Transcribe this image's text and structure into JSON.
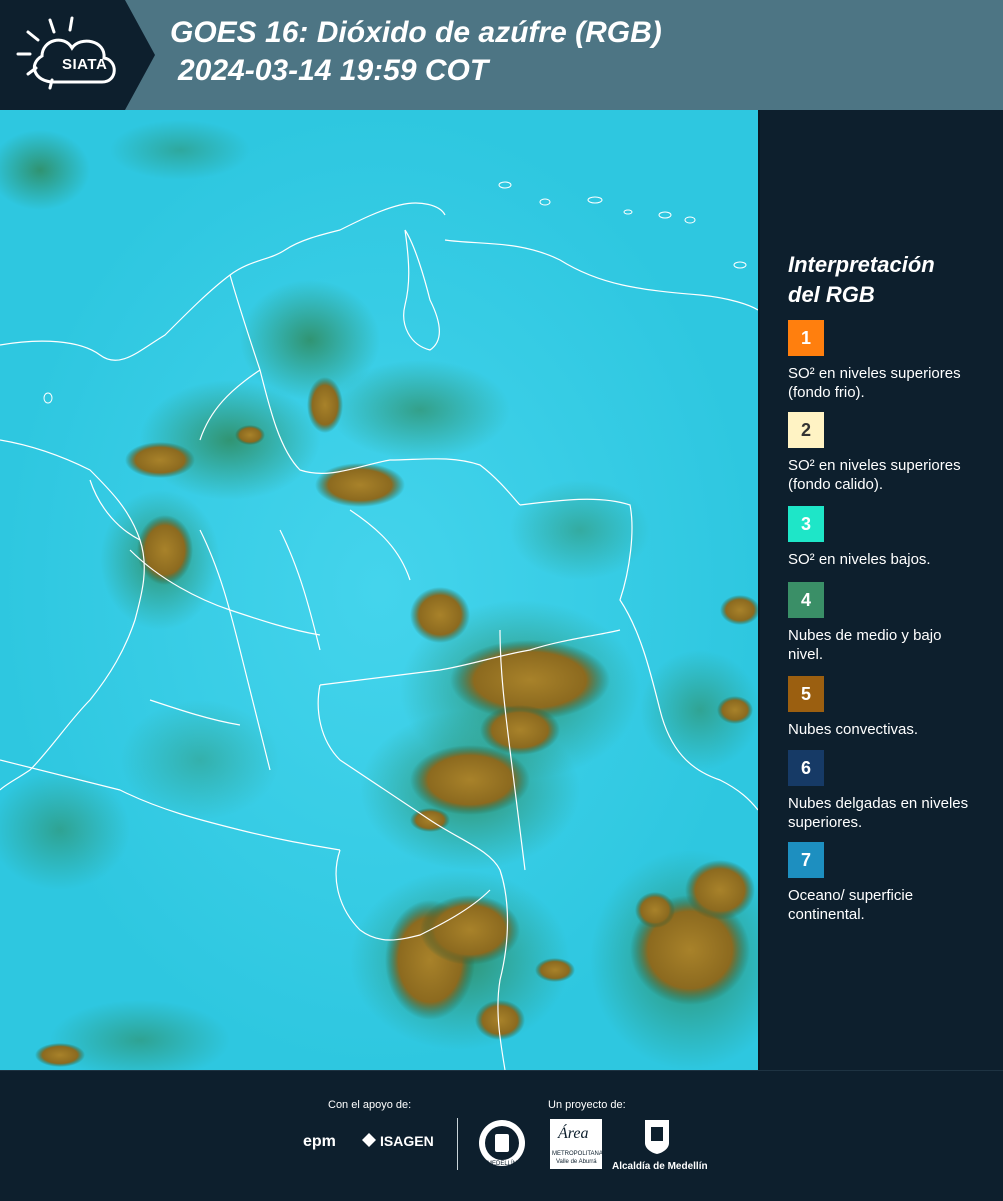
{
  "header": {
    "title": "GOES 16: Dióxido de azúfre (RGB)",
    "subtitle": "2024-03-14 19:59 COT",
    "logo_text": "SIATA",
    "background": "#4d7584",
    "dark": "#0d1f2d"
  },
  "legend": {
    "title_line1": "Interpretación",
    "title_line2": "del RGB",
    "items": [
      {
        "number": "1",
        "color": "#ff7f0e",
        "label": "SO² en niveles superiores (fondo frio)."
      },
      {
        "number": "2",
        "color": "#fff3c4",
        "label": "SO² en niveles superiores (fondo calido)."
      },
      {
        "number": "3",
        "color": "#1ee6c8",
        "label": "SO² en niveles bajos."
      },
      {
        "number": "4",
        "color": "#3a8f67",
        "label": "Nubes de medio y bajo nivel."
      },
      {
        "number": "5",
        "color": "#9b5f10",
        "label": "Nubes convectivas."
      },
      {
        "number": "6",
        "color": "#163a66",
        "label": "Nubes delgadas en niveles superiores."
      },
      {
        "number": "7",
        "color": "#1d8fc0",
        "label": "Oceano/ superficie continental."
      }
    ]
  },
  "footer": {
    "support_label": "Con el apoyo de:",
    "project_label": "Un proyecto de:",
    "sponsor1": "epm",
    "sponsor2": "ISAGEN",
    "partner1": "MEDELLÍN",
    "partner2_name": "Área",
    "partner2_sub": "METROPOLITANA",
    "partner2_sub2": "Valle de Aburrá",
    "partner3": "Alcaldía de Medellín"
  },
  "map": {
    "surface_color": "#2ec7e0",
    "convective_color": "#9b7b2a",
    "low_cloud_color": "#3a8f67",
    "border_color": "#ffffff"
  }
}
